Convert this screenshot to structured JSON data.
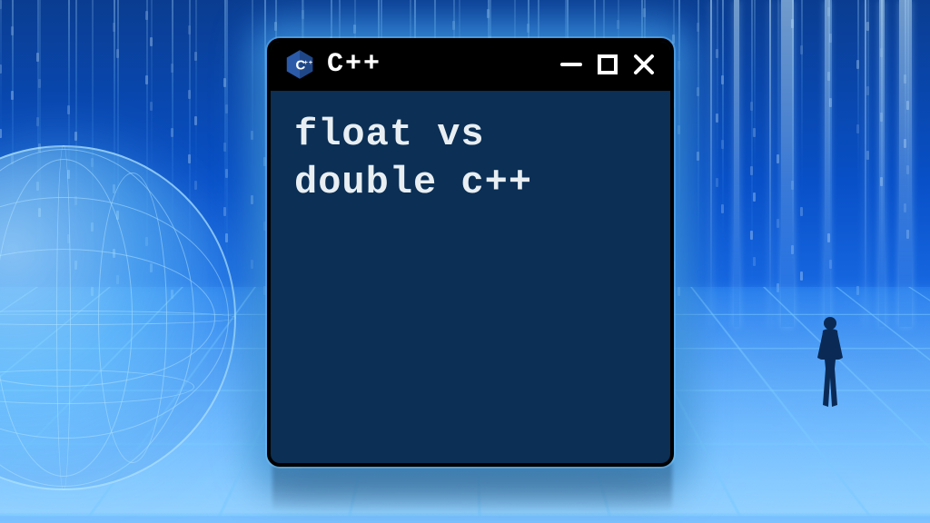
{
  "window": {
    "title": "C++",
    "body_text": "float vs\ndouble c++",
    "logo_label": "C++"
  },
  "colors": {
    "terminal_bg": "#0b2f55",
    "border": "#000000",
    "glow": "#50b4ff"
  }
}
